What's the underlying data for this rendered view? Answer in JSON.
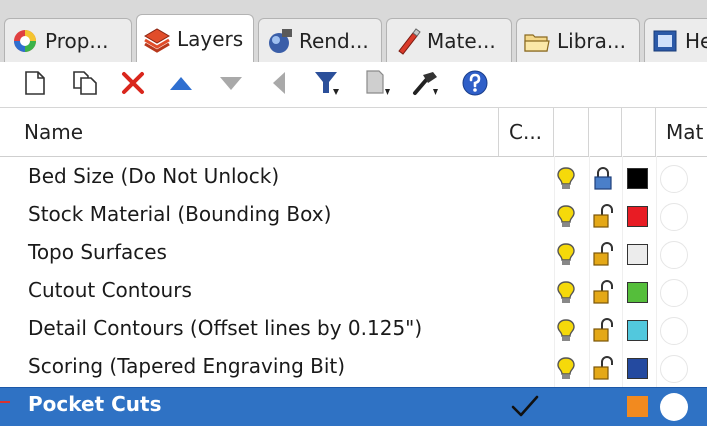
{
  "tabs": [
    {
      "label": "Prop...",
      "icon": "properties-icon",
      "active": false
    },
    {
      "label": "Layers",
      "icon": "layers-icon",
      "active": true
    },
    {
      "label": "Rend...",
      "icon": "rendering-icon",
      "active": false
    },
    {
      "label": "Mate...",
      "icon": "materials-icon",
      "active": false
    },
    {
      "label": "Libra...",
      "icon": "libraries-icon",
      "active": false
    },
    {
      "label": "He",
      "icon": "help-icon",
      "active": false
    }
  ],
  "toolbar": {
    "buttons": [
      "new-layer-icon",
      "new-sublayer-icon",
      "delete-icon",
      "move-up-icon",
      "move-down-icon",
      "move-out-icon",
      "filter-icon",
      "layer-states-icon",
      "tools-icon",
      "help-icon"
    ]
  },
  "columns": {
    "name": "Name",
    "current": "C...",
    "material": "Mat"
  },
  "layers": [
    {
      "name": "Bed Size (Do Not Unlock)",
      "color": "#000000",
      "locked": true
    },
    {
      "name": "Stock Material (Bounding Box)",
      "color": "#e81c24",
      "locked": false
    },
    {
      "name": "Topo Surfaces",
      "color": "#ececec",
      "locked": false
    },
    {
      "name": "Cutout Contours",
      "color": "#55be3b",
      "locked": false
    },
    {
      "name": "Detail Contours (Offset lines by 0.125\")",
      "color": "#52c8dd",
      "locked": false
    },
    {
      "name": "Scoring (Tapered Engraving Bit)",
      "color": "#244aa0",
      "locked": false
    },
    {
      "name": "Pocket Cuts",
      "color": "#f28a1f",
      "locked": false,
      "selected": true,
      "current": true
    }
  ],
  "colors": {
    "selection": "#2f72c4",
    "bulb": "#f5d90a",
    "lock_locked": "#4a7fc9",
    "lock_unlocked": "#e4a817"
  }
}
